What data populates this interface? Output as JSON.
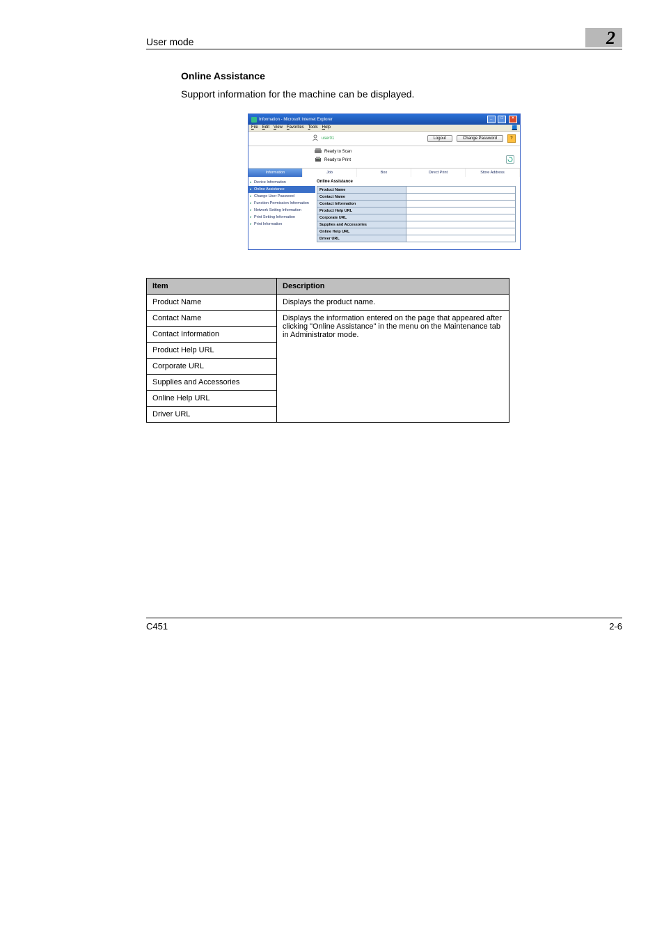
{
  "header": {
    "section": "User mode",
    "chapter": "2"
  },
  "section": {
    "heading": "Online Assistance",
    "body": "Support information for the machine can be displayed."
  },
  "browser": {
    "title": "Information - Microsoft Internet Explorer",
    "menus": [
      "File",
      "Edit",
      "View",
      "Favorites",
      "Tools",
      "Help"
    ],
    "user": "user01",
    "buttons": {
      "logout": "Logout",
      "change_pw": "Change Password"
    },
    "status": {
      "scan": "Ready to Scan",
      "print": "Ready to Print"
    },
    "tabs": [
      "Information",
      "Job",
      "Box",
      "Direct Print",
      "Store Address"
    ],
    "sidebar": [
      "Device Information",
      "Online Assistance",
      "Change User Password",
      "Function Permission Information",
      "Network Setting Information",
      "Print Setting Information",
      "Print Information"
    ],
    "pane_title": "Online Assistance",
    "rows": [
      "Product Name",
      "Contact Name",
      "Contact Information",
      "Product Help URL",
      "Corporate URL",
      "Supplies and Accessories",
      "Online Help URL",
      "Driver URL"
    ]
  },
  "table": {
    "head": {
      "item": "Item",
      "desc": "Description"
    },
    "rows": [
      "Product Name",
      "Contact Name",
      "Contact Information",
      "Product Help URL",
      "Corporate URL",
      "Supplies and Accessories",
      "Online Help URL",
      "Driver URL"
    ],
    "desc_first": "Displays the product name.",
    "desc_rest": "Displays the information entered on the page that appeared after clicking \"Online Assistance\" in the menu on the Maintenance tab in Administrator mode."
  },
  "footer": {
    "model": "C451",
    "page": "2-6"
  }
}
